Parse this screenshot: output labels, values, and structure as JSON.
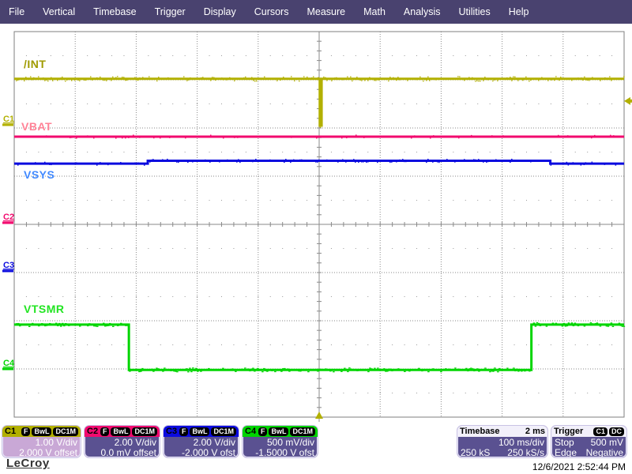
{
  "menu": {
    "items": [
      "File",
      "Vertical",
      "Timebase",
      "Trigger",
      "Display",
      "Cursors",
      "Measure",
      "Math",
      "Analysis",
      "Utilities",
      "Help"
    ]
  },
  "logo_text": "LeCroy",
  "datetime": "12/6/2021 2:52:44 PM",
  "colors": {
    "menubar_bg": "#49426f",
    "grid": "#8a8a8a",
    "c1": "#b2b000",
    "c1_label": "#a09b00",
    "c2": "#f20a6e",
    "c2_label": "#ff8296",
    "c3": "#0b0bdf",
    "c3_label": "#4189ff",
    "c4": "#00d500",
    "c4_label": "#22e522",
    "panel_body": "#5a5191",
    "selected_body": "#c9a8d6"
  },
  "channels": [
    {
      "id": "C1",
      "trace_label": "/INT",
      "badges": [
        "F",
        "BwL",
        "DC1M"
      ],
      "scale": "1.00 V/div",
      "offset": "2.000 V offset",
      "zero_div": 1.934,
      "selected": true
    },
    {
      "id": "C2",
      "trace_label": "VBAT",
      "badges": [
        "F",
        "BwL",
        "DC1M"
      ],
      "scale": "2.00 V/div",
      "offset": "0.0 mV offset",
      "zero_div": 3.967,
      "selected": false
    },
    {
      "id": "C3",
      "trace_label": "VSYS",
      "badges": [
        "F",
        "BwL",
        "DC1M"
      ],
      "scale": "2.00 V/div",
      "offset": "-2.000 V ofst",
      "zero_div": 4.967,
      "selected": false
    },
    {
      "id": "C4",
      "trace_label": "VTSMR",
      "badges": [
        "F",
        "BwL",
        "DC1M"
      ],
      "scale": "500 mV/div",
      "offset": "-1.5000 V ofst",
      "zero_div": 7.0,
      "selected": false
    }
  ],
  "timebase": {
    "title": "Timebase",
    "delay": "2 ms",
    "scale": "100 ms/div",
    "samples": "250 kS",
    "rate": "250 kS/s"
  },
  "trigger": {
    "title": "Trigger",
    "badges": [
      "C1",
      "DC"
    ],
    "mode": "Stop",
    "level": "500 mV",
    "type": "Edge",
    "slope": "Negative",
    "level_div": 1.44,
    "position_div": 5.0
  },
  "chart_data": {
    "type": "line",
    "title": "Oscilloscope capture: /INT, VBAT, VSYS, VTSMR",
    "x_units": "time divisions (100 ms/div, 10 divisions total)",
    "y_units": "grid divisions from top (8 divisions total)",
    "grid": {
      "x_divs": 10,
      "y_divs": 8
    },
    "series": [
      {
        "name": "/INT",
        "channel": "C1",
        "color": "#b2b000",
        "noise": {
          "density": 0.45,
          "amp": 2,
          "w": 1.5
        },
        "points": [
          [
            0,
            0.98
          ],
          [
            5.01,
            0.98
          ],
          [
            5.01,
            1.95
          ],
          [
            5.04,
            1.95
          ],
          [
            5.04,
            0.98
          ],
          [
            10,
            0.98
          ]
        ]
      },
      {
        "name": "VBAT",
        "channel": "C2",
        "color": "#f20a6e",
        "noise": {
          "density": 0.12,
          "amp": 1,
          "w": 1.5
        },
        "points": [
          [
            0,
            2.18
          ],
          [
            10,
            2.18
          ]
        ]
      },
      {
        "name": "VSYS",
        "channel": "C3",
        "color": "#0b0bdf",
        "noise": {
          "density": 0.2,
          "amp": 1,
          "w": 1.5
        },
        "points": [
          [
            0,
            2.74
          ],
          [
            2.19,
            2.74
          ],
          [
            2.19,
            2.68
          ],
          [
            8.79,
            2.68
          ],
          [
            8.79,
            2.74
          ],
          [
            10,
            2.74
          ]
        ]
      },
      {
        "name": "VTSMR",
        "channel": "C4",
        "color": "#00d500",
        "noise": {
          "density": 0.42,
          "amp": 1.5,
          "w": 2.5
        },
        "points": [
          [
            0,
            6.08
          ],
          [
            1.88,
            6.08
          ],
          [
            1.88,
            7.02
          ],
          [
            8.48,
            7.02
          ],
          [
            8.48,
            6.08
          ],
          [
            10,
            6.08
          ]
        ]
      }
    ]
  }
}
